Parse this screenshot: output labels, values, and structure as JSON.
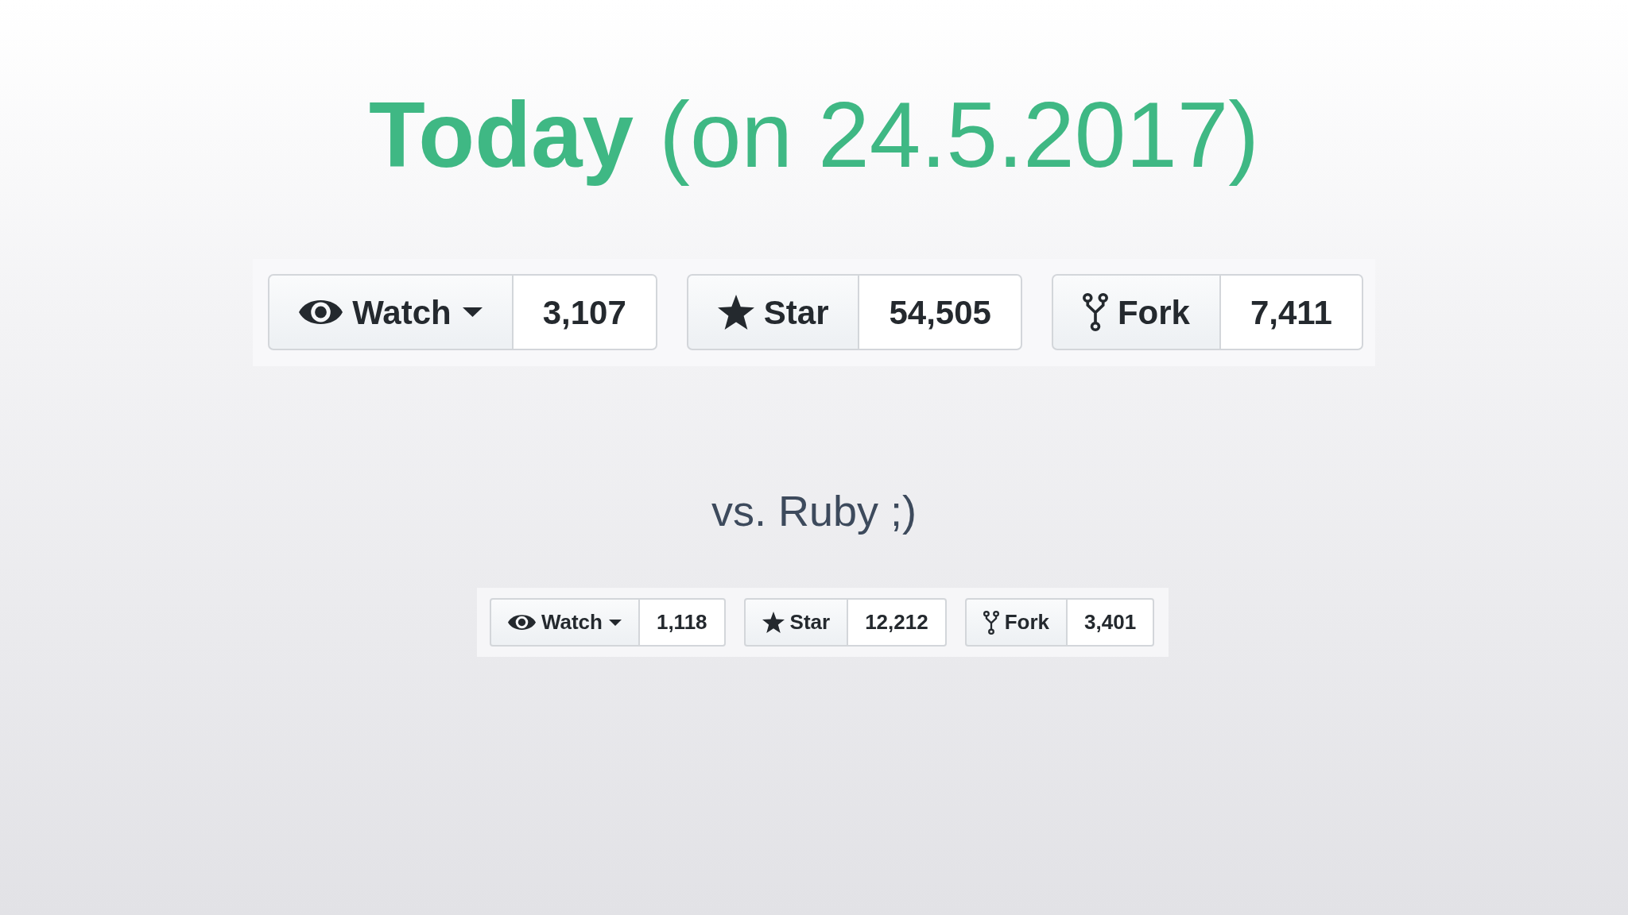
{
  "title": "**Today** (on 24.5.2017)",
  "sections": [
    {
      "buttons": [
        {
          "kind": "watch",
          "label": "Watch",
          "count": "3,107"
        },
        {
          "kind": "star",
          "label": "Star",
          "count": "54,505"
        },
        {
          "kind": "fork",
          "label": "Fork",
          "count": "7,411"
        }
      ]
    },
    {
      "caption": "vs. Ruby ;)",
      "buttons": [
        {
          "kind": "watch",
          "label": "Watch",
          "count": "1,118"
        },
        {
          "kind": "star",
          "label": "Star",
          "count": "12,212"
        },
        {
          "kind": "fork",
          "label": "Fork",
          "count": "3,401"
        }
      ]
    }
  ]
}
